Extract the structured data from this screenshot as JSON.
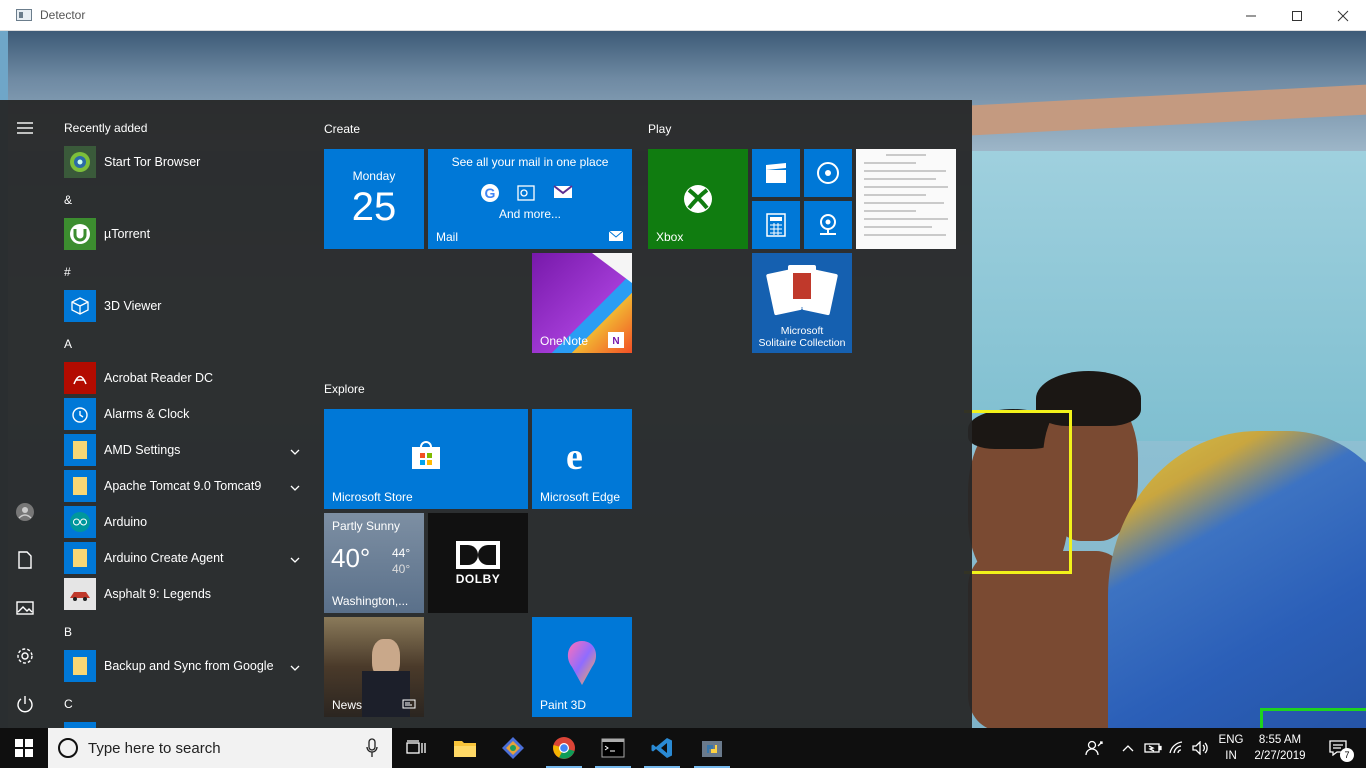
{
  "window": {
    "title": "Detector"
  },
  "start_menu": {
    "app_list": {
      "header": "Recently added",
      "groups": [
        {
          "letter": "",
          "apps": [
            {
              "label": "Start Tor Browser",
              "icon": "tor-icon"
            }
          ]
        },
        {
          "letter": "&",
          "apps": [
            {
              "label": "µTorrent",
              "icon": "utorrent-icon"
            }
          ]
        },
        {
          "letter": "#",
          "apps": [
            {
              "label": "3D Viewer",
              "icon": "cube-icon"
            }
          ]
        },
        {
          "letter": "A",
          "apps": [
            {
              "label": "Acrobat Reader DC",
              "icon": "acrobat-icon"
            },
            {
              "label": "Alarms & Clock",
              "icon": "alarm-clock-icon"
            },
            {
              "label": "AMD Settings",
              "icon": "folder-icon",
              "expandable": true
            },
            {
              "label": "Apache Tomcat 9.0 Tomcat9",
              "icon": "folder-icon",
              "expandable": true
            },
            {
              "label": "Arduino",
              "icon": "arduino-icon"
            },
            {
              "label": "Arduino Create Agent",
              "icon": "folder-icon",
              "expandable": true
            },
            {
              "label": "Asphalt 9: Legends",
              "icon": "asphalt-icon"
            }
          ]
        },
        {
          "letter": "B",
          "apps": [
            {
              "label": "Backup and Sync from Google",
              "icon": "folder-icon",
              "expandable": true
            }
          ]
        },
        {
          "letter": "C",
          "apps": []
        }
      ]
    },
    "sections": {
      "create": "Create",
      "play": "Play",
      "explore": "Explore"
    },
    "tiles": {
      "calendar": {
        "day": "Monday",
        "date": "25"
      },
      "mail": {
        "headline": "See all your mail in one place",
        "more": "And more...",
        "label": "Mail"
      },
      "onenote": {
        "label": "OneNote"
      },
      "xbox": {
        "label": "Xbox"
      },
      "solitaire": {
        "line1": "Microsoft",
        "line2": "Solitaire Collection"
      },
      "store": {
        "label": "Microsoft Store"
      },
      "edge": {
        "label": "Microsoft Edge"
      },
      "weather": {
        "condition": "Partly Sunny",
        "temp": "40°",
        "high": "44°",
        "low": "40°",
        "location": "Washington,..."
      },
      "dolby": {
        "label": "DOLBY"
      },
      "news": {
        "label": "News"
      },
      "paint3d": {
        "label": "Paint 3D"
      }
    }
  },
  "taskbar": {
    "search_placeholder": "Type here to search",
    "language": {
      "line1": "ENG",
      "line2": "IN"
    },
    "clock": {
      "time": "8:55 AM",
      "date": "2/27/2019"
    },
    "notification_count": "7"
  },
  "colors": {
    "tile_blue": "#0078d7",
    "xbox_green": "#107c10",
    "box_yellow": "#f2f21a",
    "box_green": "#1ed31e"
  }
}
